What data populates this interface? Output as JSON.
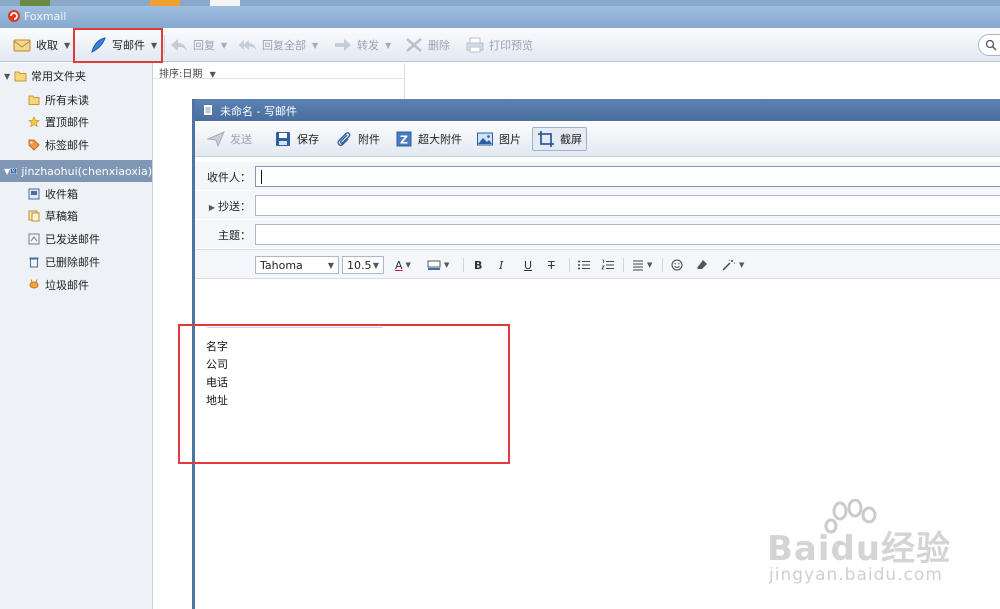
{
  "app": {
    "title": "Foxmail"
  },
  "toolbar": {
    "receive": "收取",
    "write": "写邮件",
    "reply": "回复",
    "reply_all": "回复全部",
    "forward": "转发",
    "delete": "删除",
    "print_preview": "打印预览"
  },
  "sidebar": {
    "common_folder": "常用文件夹",
    "common_items": [
      "所有未读",
      "置顶邮件",
      "标签邮件"
    ],
    "account": "jinzhaohui(chenxiaoxia)",
    "account_items": [
      "收件箱",
      "草稿箱",
      "已发送邮件",
      "已删除邮件",
      "垃圾邮件"
    ]
  },
  "list": {
    "sort_label": "排序:日期"
  },
  "compose": {
    "window_title": "未命名 - 写邮件",
    "toolbar": {
      "send": "发送",
      "save": "保存",
      "attach": "附件",
      "big_attach": "超大附件",
      "image": "图片",
      "screenshot": "截屏"
    },
    "fields": {
      "to_label": "收件人：",
      "cc_label": "抄送：",
      "subject_label": "主题：",
      "to_value": "",
      "cc_value": "",
      "subject_value": ""
    },
    "format": {
      "font": "Tahoma",
      "size": "10.5",
      "font_color": "A",
      "bold": "B",
      "italic": "I",
      "underline": "U",
      "strike": "T"
    },
    "signature": [
      "名字",
      "公司",
      "电话",
      "地址"
    ]
  },
  "watermark": {
    "brand": "Baidu经验",
    "url": "jingyan.baidu.com"
  },
  "colors": {
    "highlight": "#e03a3a",
    "sidebar_accent": "#7f97b5",
    "title_bar": "#4a6f9e"
  }
}
